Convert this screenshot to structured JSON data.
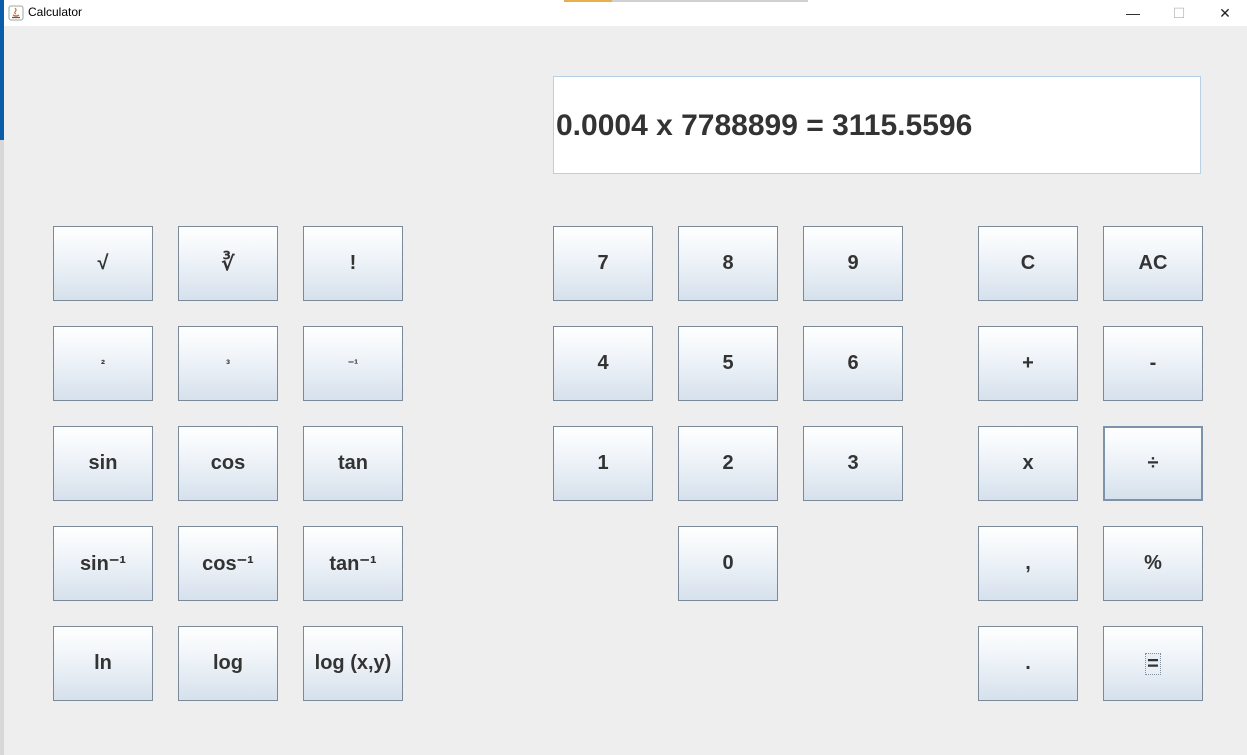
{
  "window": {
    "title": "Calculator",
    "minimize_glyph": "—",
    "maximize_glyph": "☐",
    "close_glyph": "✕"
  },
  "display": {
    "text": "0.0004 x 7788899 = 3115.5596"
  },
  "scientific": {
    "sqrt": "√",
    "cbrt": "∛",
    "factorial": "!",
    "square": "²",
    "cube": "³",
    "inverse": "⁻¹",
    "sin": "sin",
    "cos": "cos",
    "tan": "tan",
    "asin": "sin⁻¹",
    "acos": "cos⁻¹",
    "atan": "tan⁻¹",
    "ln": "ln",
    "log": "log",
    "logxy": "log (x,y)"
  },
  "digits": {
    "d7": "7",
    "d8": "8",
    "d9": "9",
    "d4": "4",
    "d5": "5",
    "d6": "6",
    "d1": "1",
    "d2": "2",
    "d3": "3",
    "d0": "0"
  },
  "operators": {
    "clear": "C",
    "all_clear": "AC",
    "plus": "+",
    "minus": "-",
    "multiply": "x",
    "divide": "÷",
    "comma": ",",
    "percent": "%",
    "decimal": ".",
    "equals": "="
  }
}
